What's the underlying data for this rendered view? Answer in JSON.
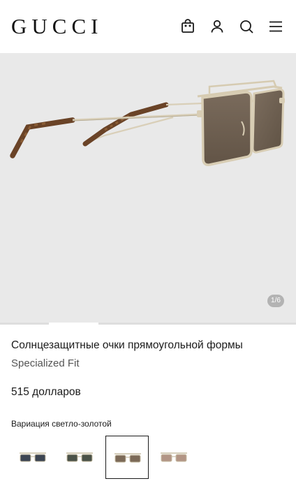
{
  "header": {
    "logo": "GUCCI",
    "icons": [
      "shopping-bag-icon",
      "user-icon",
      "search-icon",
      "menu-icon"
    ]
  },
  "gallery": {
    "counter": "1/6",
    "progress": 0.1667
  },
  "product": {
    "title": "Солнцезащитные очки прямоугольной формы",
    "subtitle": "Specialized Fit",
    "price": "515 долларов",
    "variation_label": "Вариация светло-золотой"
  },
  "variants": [
    {
      "name": "variant-blue",
      "lens": "#3c4452",
      "selected": false
    },
    {
      "name": "variant-green",
      "lens": "#4a5248",
      "selected": false
    },
    {
      "name": "variant-brown",
      "lens": "#7c6a58",
      "selected": true
    },
    {
      "name": "variant-rose",
      "lens": "#b29585",
      "selected": false
    }
  ],
  "colors": {
    "hero_background": "#e9e9e9",
    "frame_gold": "#d8cdb4",
    "lens_brown": "#6f6052",
    "tortoise": "#6a4327"
  }
}
